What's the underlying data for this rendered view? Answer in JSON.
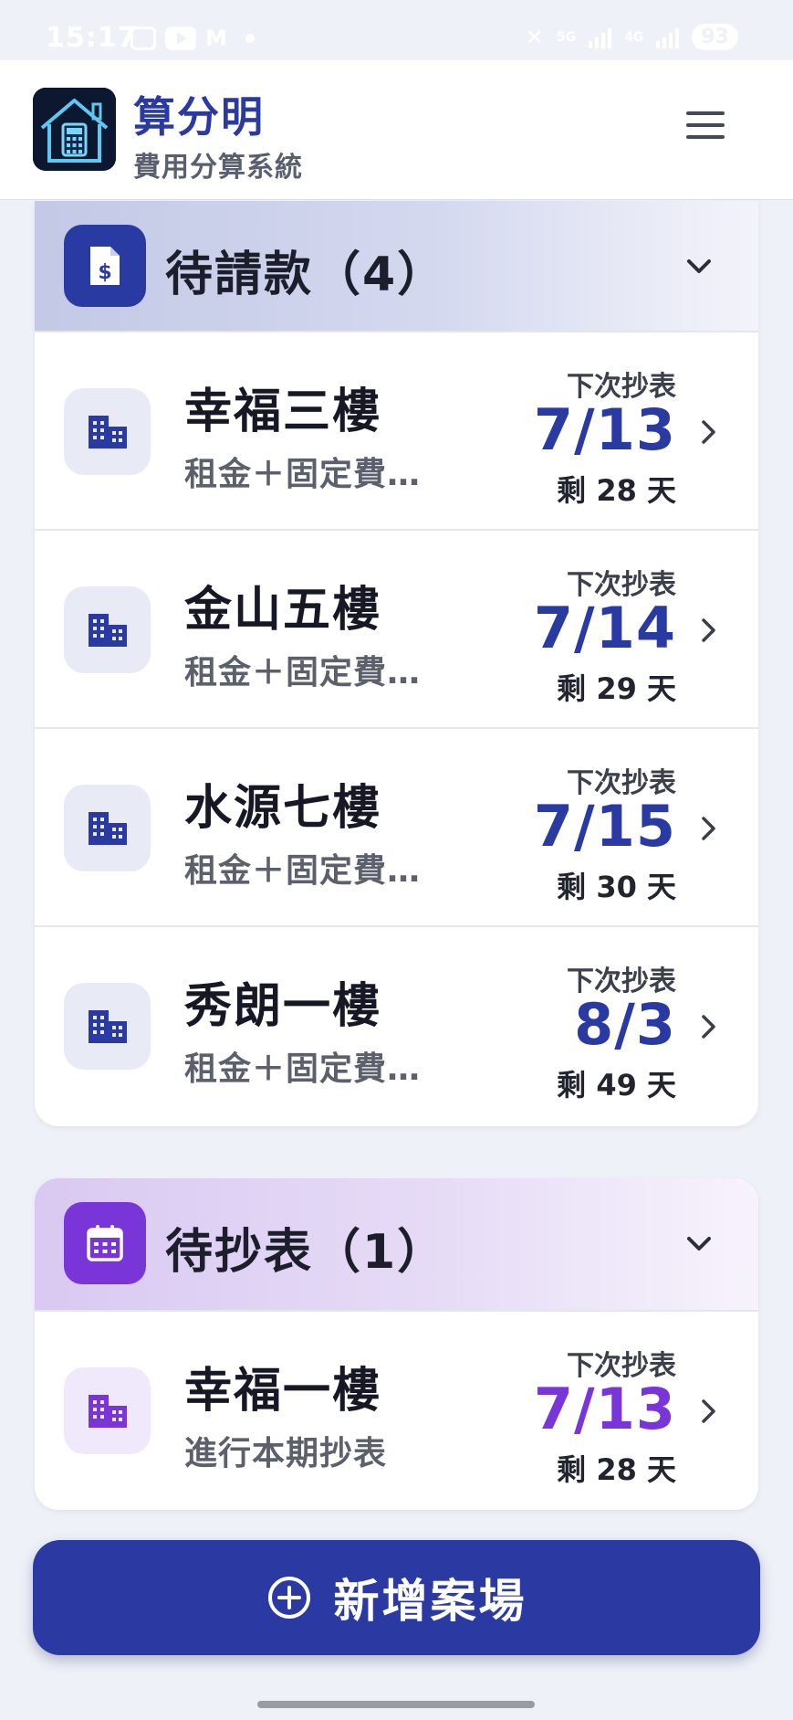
{
  "status_bar": {
    "time": "15:17",
    "network_small": "5G",
    "network_small_2": "4G",
    "battery": "93"
  },
  "header": {
    "app_title": "算分明",
    "app_subtitle": "費用分算系統",
    "logo_icon": "house-calculator-icon",
    "menu_icon": "hamburger-menu-icon"
  },
  "sections": [
    {
      "title": "待請款（4）",
      "icon": "invoice-dollar-icon",
      "accent": "#2a3aa3",
      "items": [
        {
          "name": "幸福三樓",
          "desc": "租金＋固定費…",
          "next_label": "下次抄表",
          "date": "7/13",
          "remaining": "剩 28 天"
        },
        {
          "name": "金山五樓",
          "desc": "租金＋固定費…",
          "next_label": "下次抄表",
          "date": "7/14",
          "remaining": "剩 29 天"
        },
        {
          "name": "水源七樓",
          "desc": "租金＋固定費…",
          "next_label": "下次抄表",
          "date": "7/15",
          "remaining": "剩 30 天"
        },
        {
          "name": "秀朗一樓",
          "desc": "租金＋固定費…",
          "next_label": "下次抄表",
          "date": "8/3",
          "remaining": "剩 49 天"
        }
      ]
    },
    {
      "title": "待抄表（1）",
      "icon": "calendar-icon",
      "accent": "#7a35d8",
      "items": [
        {
          "name": "幸福一樓",
          "desc": "進行本期抄表",
          "next_label": "下次抄表",
          "date": "7/13",
          "remaining": "剩 28 天"
        }
      ]
    }
  ],
  "add_button": {
    "label": "新增案場",
    "icon": "plus-circle-icon"
  }
}
